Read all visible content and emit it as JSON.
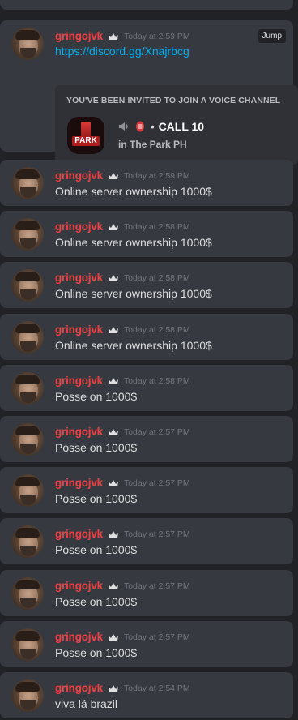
{
  "author": {
    "username": "gringojvk",
    "badge_icon": "crown-icon",
    "name_color": "#ed4245"
  },
  "first_message": {
    "timestamp": "Today at 2:59 PM",
    "link_text": "https://discord.gg/Xnajrbcg",
    "jump_label": "Jump",
    "invite": {
      "title": "YOU'VE BEEN INVITED TO JOIN A VOICE CHANNEL",
      "server_icon_word": "PARK",
      "separator": "•",
      "channel_name": "CALL 10",
      "server_line": "in The Park PH"
    }
  },
  "messages": [
    {
      "timestamp": "Today at 2:59 PM",
      "content": "Online server ownership 1000$"
    },
    {
      "timestamp": "Today at 2:58 PM",
      "content": "Online server ownership 1000$"
    },
    {
      "timestamp": "Today at 2:58 PM",
      "content": "Online server ownership 1000$"
    },
    {
      "timestamp": "Today at 2:58 PM",
      "content": "Online server ownership 1000$"
    },
    {
      "timestamp": "Today at 2:58 PM",
      "content": "Posse on 1000$"
    },
    {
      "timestamp": "Today at 2:57 PM",
      "content": "Posse on 1000$"
    },
    {
      "timestamp": "Today at 2:57 PM",
      "content": "Posse on 1000$"
    },
    {
      "timestamp": "Today at 2:57 PM",
      "content": "Posse on 1000$"
    },
    {
      "timestamp": "Today at 2:57 PM",
      "content": "Posse on 1000$"
    },
    {
      "timestamp": "Today at 2:57 PM",
      "content": "Posse on 1000$"
    },
    {
      "timestamp": "Today at 2:54 PM",
      "content": "viva lá brazil"
    }
  ]
}
